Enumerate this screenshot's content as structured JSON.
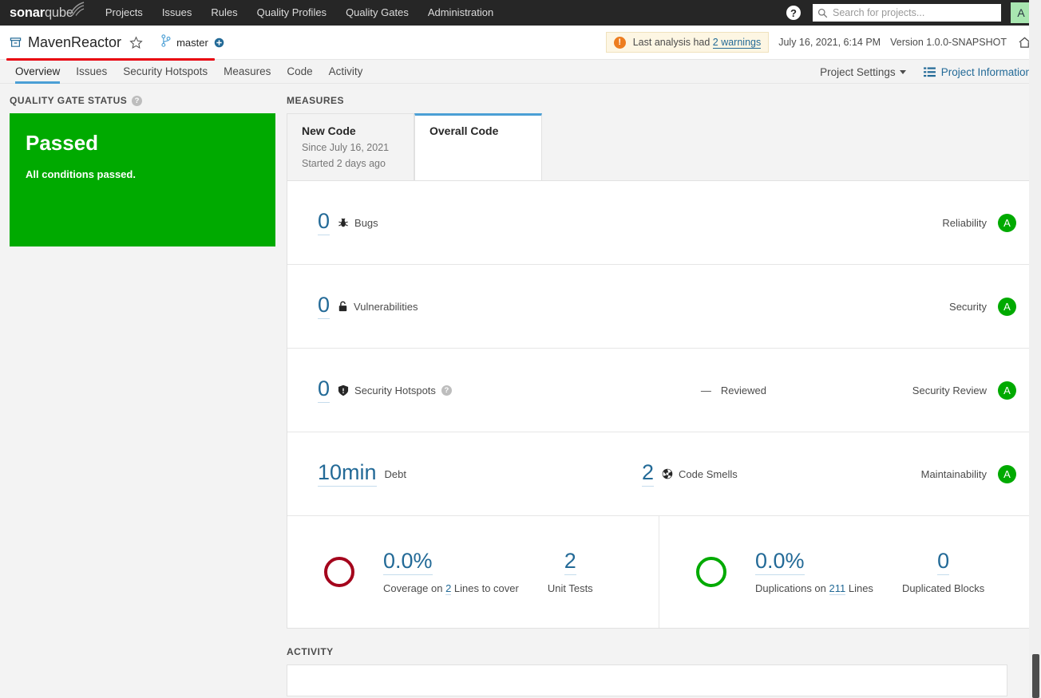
{
  "topnav": {
    "logo_bold": "sonar",
    "logo_light": "qube",
    "links": [
      "Projects",
      "Issues",
      "Rules",
      "Quality Profiles",
      "Quality Gates",
      "Administration"
    ],
    "help_glyph": "?",
    "search_placeholder": "Search for projects...",
    "avatar_initial": "A"
  },
  "project": {
    "name": "MavenReactor",
    "branch": "master",
    "warning_prefix": "Last analysis had ",
    "warning_link": "2 warnings",
    "analysis_date": "July 16, 2021, 6:14 PM",
    "version": "Version 1.0.0-SNAPSHOT"
  },
  "tabs": {
    "items": [
      {
        "label": "Overview",
        "active": true
      },
      {
        "label": "Issues",
        "active": false
      },
      {
        "label": "Security Hotspots",
        "active": false
      },
      {
        "label": "Measures",
        "active": false
      },
      {
        "label": "Code",
        "active": false
      },
      {
        "label": "Activity",
        "active": false
      }
    ],
    "project_settings": "Project Settings",
    "project_information": "Project Information"
  },
  "quality_gate": {
    "section_title": "QUALITY GATE STATUS",
    "status": "Passed",
    "description": "All conditions passed."
  },
  "measures": {
    "section_title": "MEASURES",
    "tab_new_code": {
      "title": "New Code",
      "since": "Since July 16, 2021",
      "started": "Started 2 days ago"
    },
    "tab_overall_code": {
      "title": "Overall Code"
    },
    "rows": [
      {
        "value": "0",
        "label": "Bugs",
        "icon": "bug-icon",
        "right_label": "Reliability",
        "rating": "A"
      },
      {
        "value": "0",
        "label": "Vulnerabilities",
        "icon": "lock-icon",
        "right_label": "Security",
        "rating": "A"
      },
      {
        "value": "0",
        "label": "Security Hotspots",
        "icon": "shield-icon",
        "mid_dash": "—",
        "mid_label": "Reviewed",
        "right_label": "Security Review",
        "rating": "A"
      },
      {
        "value": "10min",
        "label": "Debt",
        "mid_value": "2",
        "mid_label": "Code Smells",
        "icon": "code-smell-icon",
        "right_label": "Maintainability",
        "rating": "A"
      }
    ],
    "coverage": {
      "percent": "0.0%",
      "caption_before": "Coverage on ",
      "caption_link": "2",
      "caption_after": " Lines to cover",
      "unit_tests_value": "2",
      "unit_tests_label": "Unit Tests",
      "ring_color": "#a4041c"
    },
    "duplications": {
      "percent": "0.0%",
      "caption_before": "Duplications on ",
      "caption_link": "211",
      "caption_after": " Lines",
      "blocks_value": "0",
      "blocks_label": "Duplicated Blocks",
      "ring_color": "#00aa00"
    }
  },
  "activity": {
    "section_title": "ACTIVITY"
  }
}
